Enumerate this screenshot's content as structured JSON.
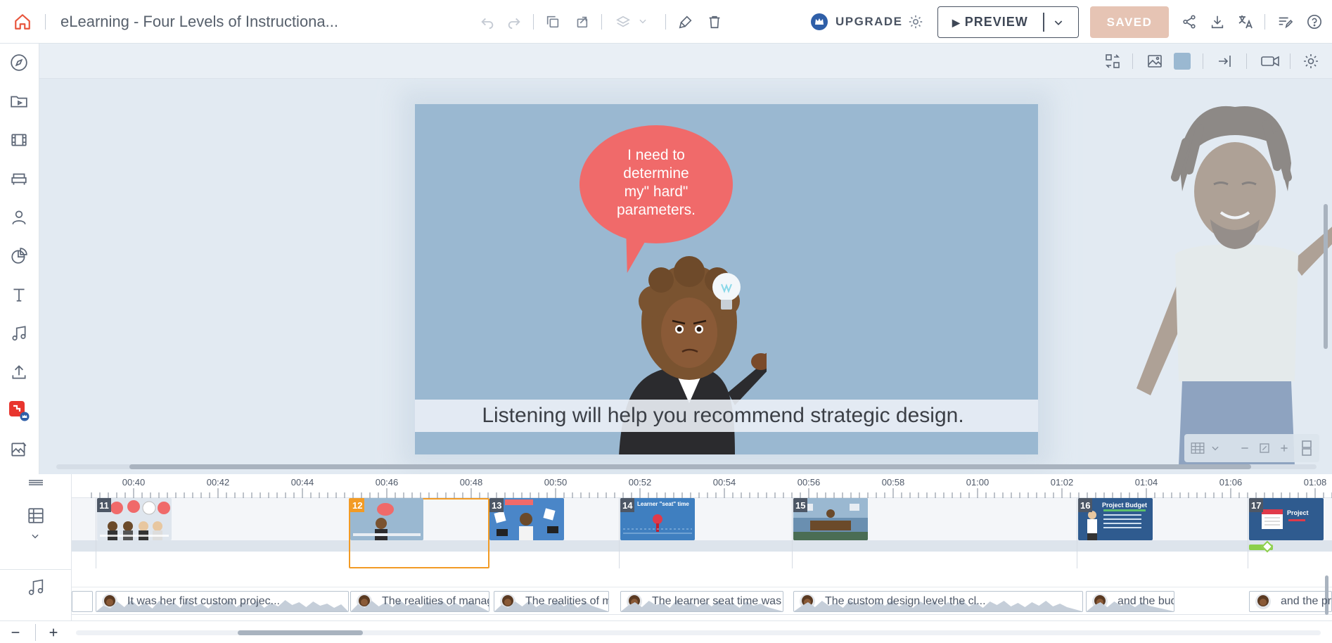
{
  "app": {
    "title": "eLearning - Four Levels of Instructiona...",
    "upgrade_label": "UPGRADE",
    "preview_label": "PREVIEW",
    "saved_label": "SAVED"
  },
  "colors": {
    "accent_orange": "#f29b25",
    "canvas_bg": "#9ab8d1",
    "bubble": "#f06a6a",
    "saved_bg": "#e6c4b4"
  },
  "left_rail": {
    "items": [
      "compass-icon",
      "media-folder-icon",
      "film-icon",
      "furniture-icon",
      "character-icon",
      "chart-icon",
      "text-icon",
      "music-icon",
      "upload-icon",
      "brand-plugin-icon",
      "image-edit-icon"
    ]
  },
  "canvas": {
    "speech_bubble": "I need to\ndetermine\nmy\" hard\"\nparameters.",
    "subtitle": "Listening will help you recommend strategic design."
  },
  "timeline": {
    "time_labels": [
      "00:40",
      "00:42",
      "00:44",
      "00:46",
      "00:48",
      "00:50",
      "00:52",
      "00:54",
      "00:56",
      "00:58",
      "01:00",
      "01:02",
      "01:04",
      "01:06",
      "01:08"
    ],
    "scenes": [
      {
        "num": "11",
        "title": ""
      },
      {
        "num": "12",
        "title": "",
        "selected": true
      },
      {
        "num": "13",
        "title": ""
      },
      {
        "num": "14",
        "title": "Learner \"seat\" time"
      },
      {
        "num": "15",
        "title": ""
      },
      {
        "num": "16",
        "title": "Project Budget"
      },
      {
        "num": "17",
        "title": "Project"
      }
    ],
    "audio_clips": [
      {
        "text": ""
      },
      {
        "text": "It was her first custom projec..."
      },
      {
        "text": "The realities of managir"
      },
      {
        "text": "The realities of ma"
      },
      {
        "text": "The learner seat time was to"
      },
      {
        "text": "The custom design level the cl..."
      },
      {
        "text": "and the budg"
      },
      {
        "text": "and the pro"
      }
    ]
  }
}
